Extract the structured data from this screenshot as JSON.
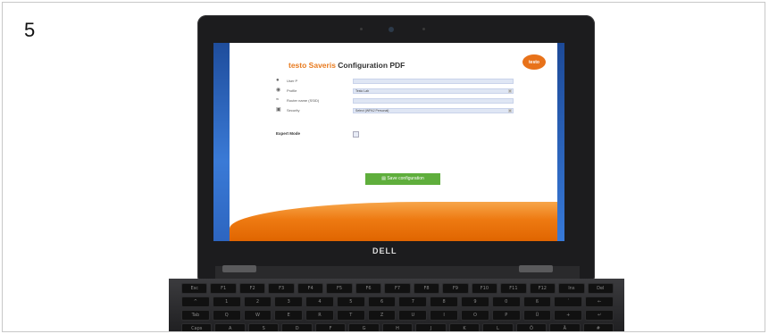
{
  "step_number": "5",
  "laptop_brand": "DELL",
  "app": {
    "title_brand": "testo Saveris",
    "title_rest": "Configuration PDF",
    "logo_text": "testo"
  },
  "form": {
    "rows": [
      {
        "icon": "user-icon",
        "label": "User P",
        "value": ""
      },
      {
        "icon": "location-pin-icon",
        "label": "Profile",
        "value": "Testo Lab"
      },
      {
        "icon": "wifi-icon",
        "label": "Router name (SSID)",
        "value": ""
      },
      {
        "icon": "lock-icon",
        "label": "Security",
        "value": "Select (WPA2 Personal)"
      }
    ],
    "expert_mode_label": "Expert Mode",
    "save_label": "Save configuration",
    "save_icon": "save-icon"
  },
  "colors": {
    "brand_orange": "#e87a1e",
    "save_green": "#5fae3c",
    "desktop_blue": "#2d65c0"
  },
  "keyboard": {
    "row1": [
      "Esc",
      "F1",
      "F2",
      "F3",
      "F4",
      "F5",
      "F6",
      "F7",
      "F8",
      "F9",
      "F10",
      "F11",
      "F12",
      "Ins",
      "Del"
    ],
    "row2": [
      "^",
      "1",
      "2",
      "3",
      "4",
      "5",
      "6",
      "7",
      "8",
      "9",
      "0",
      "ß",
      "´",
      "←"
    ],
    "row3": [
      "Tab",
      "Q",
      "W",
      "E",
      "R",
      "T",
      "Z",
      "U",
      "I",
      "O",
      "P",
      "Ü",
      "+",
      "↵"
    ],
    "row4": [
      "Caps",
      "A",
      "S",
      "D",
      "F",
      "G",
      "H",
      "J",
      "K",
      "L",
      "Ö",
      "Ä",
      "#"
    ]
  }
}
